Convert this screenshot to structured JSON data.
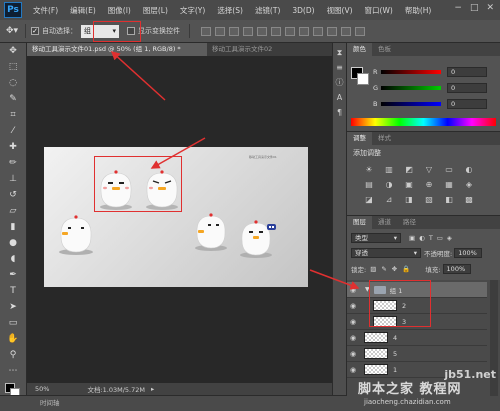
{
  "app": {
    "logo": "Ps"
  },
  "menu": [
    "文件(F)",
    "编辑(E)",
    "图像(I)",
    "图层(L)",
    "文字(Y)",
    "选择(S)",
    "滤镜(T)",
    "3D(D)",
    "视图(V)",
    "窗口(W)",
    "帮助(H)"
  ],
  "window_controls": [
    "−",
    "□",
    "✕"
  ],
  "options": {
    "auto_select_label": "自动选择：",
    "auto_select_value": "组",
    "show_transform_label": "显示变换控件"
  },
  "tabs": {
    "active": "移动工具演示文件01.psd @ 50% (组 1, RGB/8) *",
    "inactive": "移动工具演示文件02"
  },
  "status": {
    "zoom": "50%",
    "doc_size": "文档:1.03M/5.72M"
  },
  "timeline_label": "时间轴",
  "color_panel": {
    "tabs": [
      "颜色",
      "色板"
    ],
    "sliders": [
      {
        "letter": "R",
        "value": "0",
        "color": "#e02020"
      },
      {
        "letter": "G",
        "value": "0",
        "color": "#20b020"
      },
      {
        "letter": "B",
        "value": "0",
        "color": "#2050e0"
      }
    ]
  },
  "adjust_panel": {
    "tabs": [
      "调整",
      "样式"
    ],
    "title": "添加调整",
    "icons": [
      "☀",
      "▥",
      "◩",
      "▽",
      "▭",
      "◐",
      "▤",
      "◑",
      "▣",
      "⊕",
      "▦",
      "◈",
      "◪",
      "⊿",
      "◨",
      "▧",
      "◧",
      "▩"
    ]
  },
  "layers_panel": {
    "tabs": [
      "图层",
      "通道",
      "路径"
    ],
    "filter_label": "类型",
    "blend_mode": "穿透",
    "opacity_label": "不透明度:",
    "opacity_value": "100%",
    "lock_label": "锁定:",
    "fill_label": "填充:",
    "fill_value": "100%",
    "layers": [
      {
        "name": "组 1",
        "type": "group"
      },
      {
        "name": "2",
        "type": "layer"
      },
      {
        "name": "3",
        "type": "layer"
      },
      {
        "name": "4",
        "type": "layer"
      },
      {
        "name": "5",
        "type": "layer"
      },
      {
        "name": "1",
        "type": "layer"
      }
    ]
  },
  "watermark": {
    "domain": "jb51.net",
    "cn": "脚本之家 教程网",
    "sub": "jiaocheng.chazidian.com"
  },
  "canvas_caption": "移动工具演示文件01"
}
